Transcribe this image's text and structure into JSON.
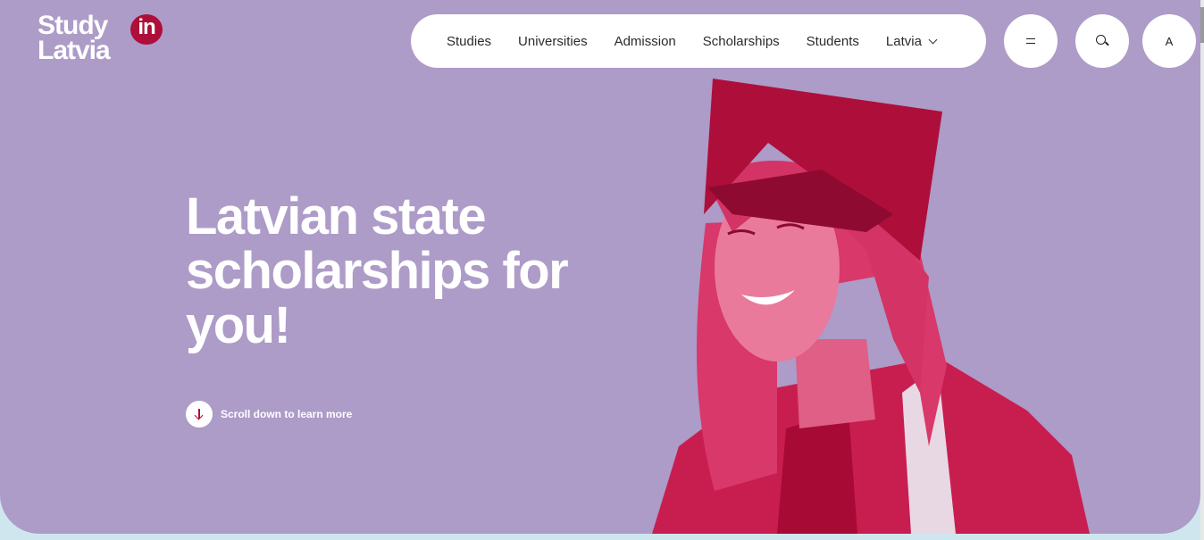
{
  "logo": {
    "line1": "Study",
    "badge": "in",
    "line2": "Latvia"
  },
  "nav": {
    "items": [
      "Studies",
      "Universities",
      "Admission",
      "Scholarships",
      "Students"
    ],
    "country": "Latvia"
  },
  "header_buttons": {
    "language": "A"
  },
  "hero": {
    "headline_line1": "Latvian state",
    "headline_line2": "scholarships for",
    "headline_line3": "you!",
    "scroll_label": "Scroll down to learn more"
  },
  "colors": {
    "background": "#ad9bc8",
    "accent": "#ad0f3a",
    "photo_tint": "#d62b5f"
  },
  "icons": [
    "menu-icon",
    "search-icon",
    "arrow-down-icon",
    "chevron-down-icon"
  ]
}
